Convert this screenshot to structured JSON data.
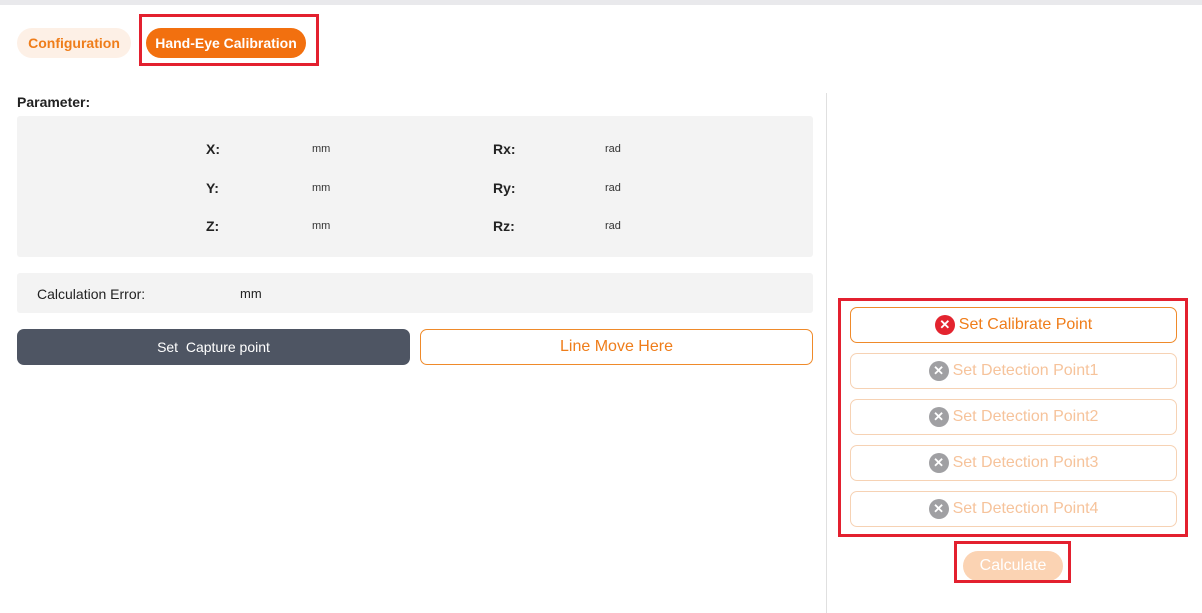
{
  "tabs": [
    {
      "label": "Configuration",
      "active": false
    },
    {
      "label": "Hand-Eye Calibration",
      "active": true
    }
  ],
  "parameter": {
    "title": "Parameter:",
    "rows": [
      {
        "left_label": "X:",
        "left_unit": "mm",
        "right_label": "Rx:",
        "right_unit": "rad"
      },
      {
        "left_label": "Y:",
        "left_unit": "mm",
        "right_label": "Ry:",
        "right_unit": "rad"
      },
      {
        "left_label": "Z:",
        "left_unit": "mm",
        "right_label": "Rz:",
        "right_unit": "rad"
      }
    ]
  },
  "calculation_error": {
    "label": "Calculation Error:",
    "unit": "mm"
  },
  "actions": {
    "capture_label": "Set  Capture point",
    "line_move_label": "Line Move Here"
  },
  "points": [
    {
      "label": "Set Calibrate Point",
      "state": "active",
      "icon": "x-circle-icon"
    },
    {
      "label": "Set Detection Point1",
      "state": "disabled",
      "icon": "x-circle-icon"
    },
    {
      "label": "Set Detection Point2",
      "state": "disabled",
      "icon": "x-circle-icon"
    },
    {
      "label": "Set Detection Point3",
      "state": "disabled",
      "icon": "x-circle-icon"
    },
    {
      "label": "Set Detection Point4",
      "state": "disabled",
      "icon": "x-circle-icon"
    }
  ],
  "calculate_label": "Calculate",
  "colors": {
    "accent": "#f2700f",
    "accent_light": "#fdf0e6",
    "dark_button": "#4e5563",
    "highlight": "#e3202f",
    "error_icon": "#e3242f",
    "disabled_icon": "#a0a0a3"
  }
}
